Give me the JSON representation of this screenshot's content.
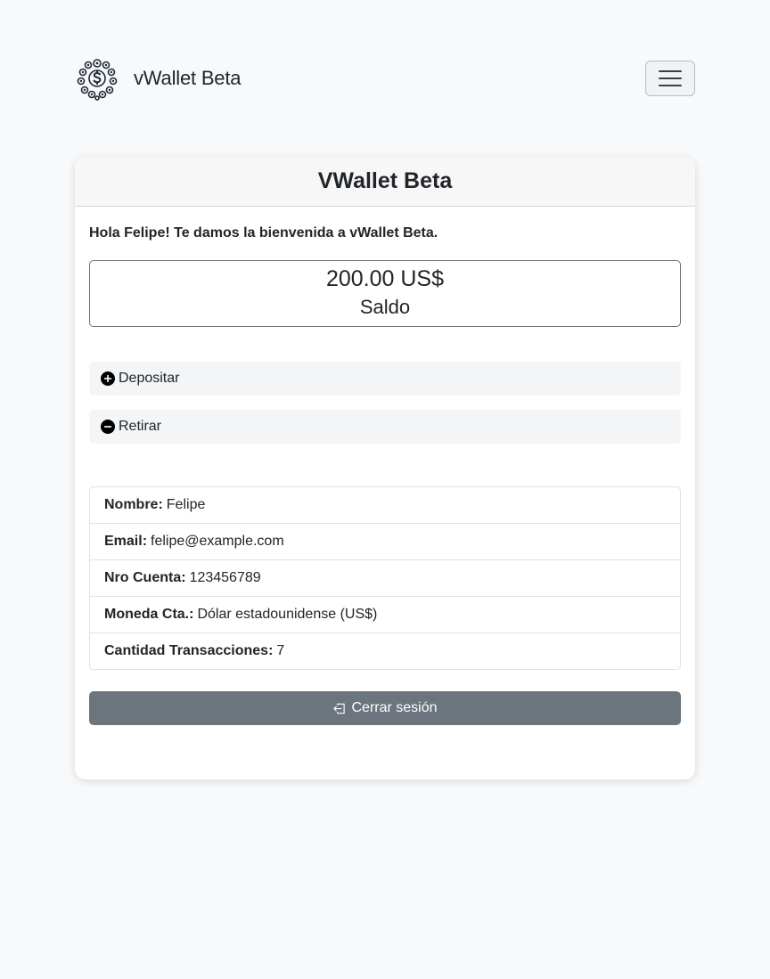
{
  "navbar": {
    "brand_text": "vWallet Beta",
    "logo_icon": "coin-cluster-logo-icon",
    "menu_icon": "hamburger-menu-icon"
  },
  "card": {
    "title": "VWallet Beta",
    "welcome": "Hola Felipe! Te damos la bienvenida a vWallet Beta.",
    "balance": {
      "amount": "200.00 US$",
      "label": "Saldo"
    },
    "actions": [
      {
        "label": "Depositar",
        "icon": "plus-circle-icon"
      },
      {
        "label": "Retirar",
        "icon": "minus-circle-icon"
      }
    ],
    "info": [
      {
        "key": "Nombre:",
        "value": "Felipe"
      },
      {
        "key": "Email:",
        "value": "felipe@example.com"
      },
      {
        "key": "Nro Cuenta:",
        "value": "123456789"
      },
      {
        "key": "Moneda Cta.:",
        "value": "Dólar estadounidense (US$)"
      },
      {
        "key": "Cantidad Transacciones:",
        "value": "7"
      }
    ],
    "logout_label": "Cerrar sesión",
    "logout_icon": "box-arrow-in-left-icon"
  },
  "colors": {
    "page_background": "#f8f9fa",
    "card_header_background": "#f7f7f7",
    "secondary_button": "#6c757d",
    "text": "#212529"
  }
}
